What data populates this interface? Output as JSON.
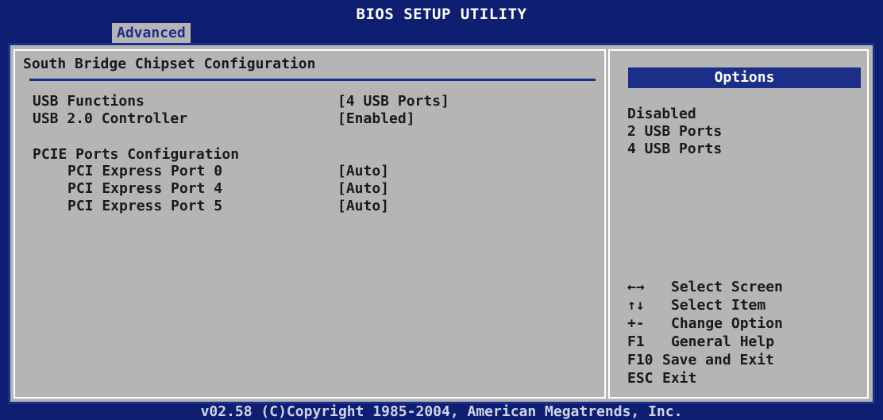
{
  "window": {
    "title": "BIOS SETUP UTILITY"
  },
  "tabs": [
    {
      "label": "Advanced",
      "active": true
    }
  ],
  "main": {
    "heading": "South Bridge Chipset Configuration",
    "usb_functions": {
      "label": "USB Functions",
      "value": "[4 USB Ports]"
    },
    "usb_controller": {
      "label": "USB 2.0 Controller",
      "value": "[Enabled]"
    },
    "pcie_heading": "PCIE Ports Configuration",
    "pcie_ports": [
      {
        "label": "PCI Express Port 0",
        "value": "[Auto]"
      },
      {
        "label": "PCI Express Port 4",
        "value": "[Auto]"
      },
      {
        "label": "PCI Express Port 5",
        "value": "[Auto]"
      }
    ]
  },
  "help_panel": {
    "title": "Options",
    "options": [
      "Disabled",
      "2 USB Ports",
      "4 USB Ports"
    ],
    "keys": [
      {
        "key": "←→",
        "action": "Select Screen",
        "icon": "left-right-arrows-icon"
      },
      {
        "key": "↑↓",
        "action": "Select Item",
        "icon": "up-down-arrows-icon"
      },
      {
        "key": "+-",
        "action": "Change Option"
      },
      {
        "key": "F1",
        "action": "General Help"
      },
      {
        "key": "F10",
        "action": "Save and Exit"
      },
      {
        "key": "ESC",
        "action": "Exit"
      }
    ]
  },
  "footer": {
    "copyright": "v02.58 (C)Copyright 1985-2004, American Megatrends, Inc."
  },
  "colors": {
    "background": "#0e1f72",
    "panel": "#b5b5b5",
    "accent": "#1b2e8a",
    "text": "#1a1a1a"
  }
}
